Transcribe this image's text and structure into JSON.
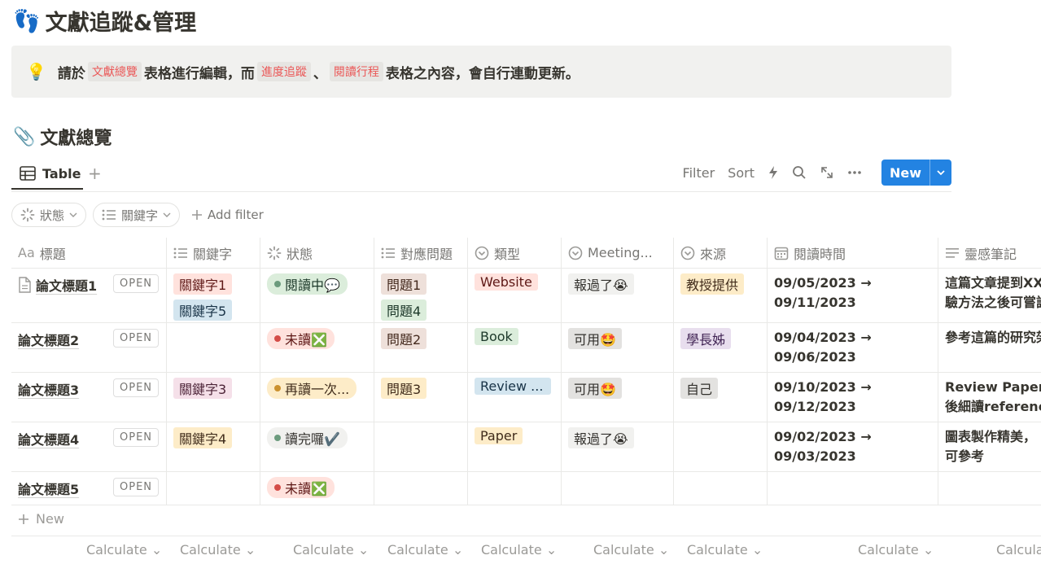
{
  "page": {
    "title_icon": "👣",
    "title": "文獻追蹤&管理"
  },
  "callout": {
    "icon": "💡",
    "t1": "請於",
    "c1": "文獻總覽",
    "t2": "表格進行編輯，而",
    "c2": "進度追蹤",
    "t3": "、",
    "c3": "閱讀行程",
    "t4": "表格之內容，會自行連動更新。"
  },
  "section": {
    "icon": "📎",
    "title": "文獻總覽"
  },
  "view": {
    "tab_label": "Table",
    "add_view": "+",
    "filter": "Filter",
    "sort": "Sort",
    "new_label": "New"
  },
  "filters": {
    "status": "狀態",
    "keyword": "關鍵字",
    "add_filter": "Add filter"
  },
  "columns": {
    "title": "標題",
    "title_prefix": "Aa",
    "keyword": "關鍵字",
    "status": "狀態",
    "question": "對應問題",
    "type": "類型",
    "meeting": "Meeting...",
    "source": "來源",
    "read_time": "閱讀時間",
    "notes": "靈感筆記"
  },
  "open_label": "OPEN",
  "rows": [
    {
      "title": "論文標題1",
      "keywords": [
        "關鍵字1",
        "關鍵字5"
      ],
      "status": "閱讀中💬",
      "questions": [
        "問題1",
        "問題4"
      ],
      "type": "Website",
      "meeting": "報過了😭",
      "source": "教授提供",
      "date1": "09/05/2023 →",
      "date2": "09/11/2023",
      "note1": "這篇文章提到XX",
      "note2": "驗方法之後可嘗試"
    },
    {
      "title": "論文標題2",
      "keywords": [],
      "status": "未讀❎",
      "questions": [
        "問題2"
      ],
      "type": "Book",
      "meeting": "可用🤩",
      "source": "學長姊",
      "date1": "09/04/2023 →",
      "date2": "09/06/2023",
      "note1": "參考這篇的研究架",
      "note2": ""
    },
    {
      "title": "論文標題3",
      "keywords": [
        "關鍵字3"
      ],
      "status": "再讀一次...",
      "questions": [
        "問題3"
      ],
      "type": "Review ...",
      "meeting": "可用🤩",
      "source": "自己",
      "date1": "09/10/2023 →",
      "date2": "09/12/2023",
      "note1": "Review Paper，",
      "note2": "後細讀reference"
    },
    {
      "title": "論文標題4",
      "keywords": [
        "關鍵字4"
      ],
      "status": "讀完囉✔️",
      "questions": [],
      "type": "Paper",
      "meeting": "報過了😭",
      "source": "",
      "date1": "09/02/2023 →",
      "date2": "09/03/2023",
      "note1": "圖表製作精美，",
      "note2": "可參考"
    },
    {
      "title": "論文標題5",
      "keywords": [],
      "status": "未讀❎",
      "questions": [],
      "type": "",
      "meeting": "",
      "source": "",
      "date1": "",
      "date2": "",
      "note1": "",
      "note2": ""
    }
  ],
  "new_row": "New",
  "calculate": "Calculate",
  "calculate_partial": "Calcula",
  "colors": {
    "accent": "#2383e2",
    "code_red": "#eb5757"
  }
}
